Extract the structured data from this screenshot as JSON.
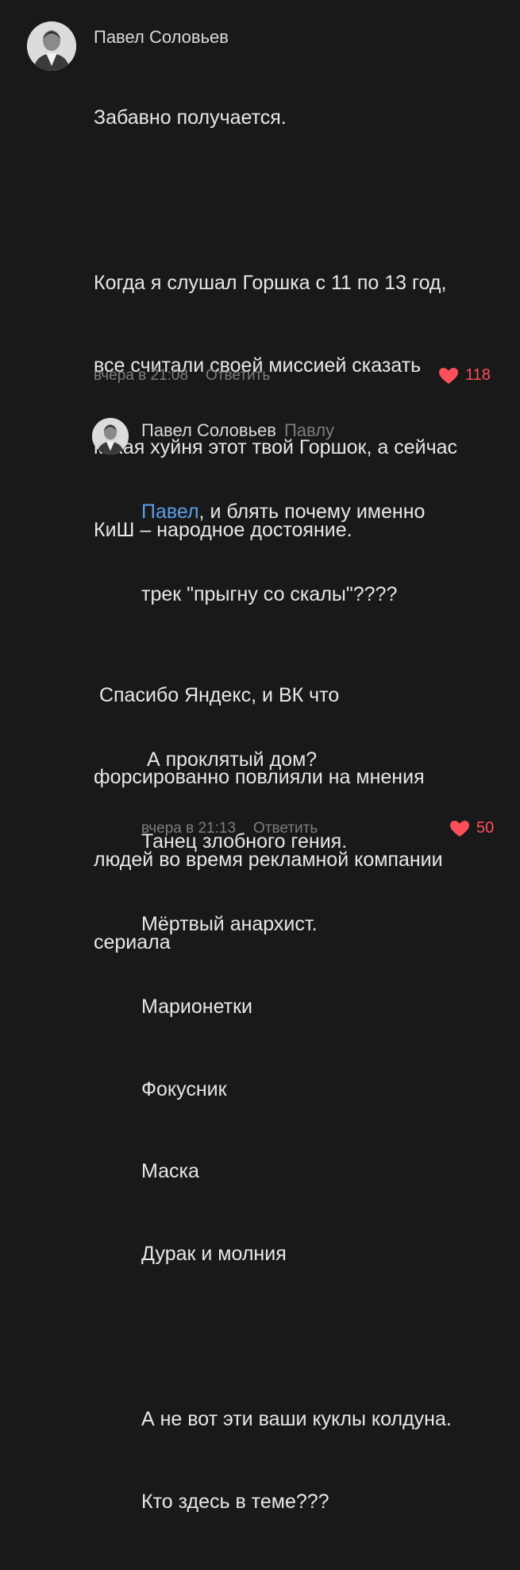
{
  "comments": [
    {
      "author": "Павел Соловьев",
      "reply_to": "",
      "lines": [
        "Забавно получается.",
        "",
        "Когда я слушал Горшка с 11 по 13 год,",
        "все считали своей миссией сказать",
        "какая хуйня этот твой Горшок, а сейчас",
        "КиШ – народное достояние.",
        "",
        " Спасибо Яндекс, и ВК что",
        "форсированно повлияли на мнения",
        "людей во время рекламной компании",
        "сериала"
      ],
      "timestamp": "вчера в 21:08",
      "reply_label": "Ответить",
      "likes": "118",
      "avatar_icon": "user-avatar-icon"
    },
    {
      "author": "Павел Соловьев",
      "reply_to": "Павлу",
      "mention": "Павел",
      "first_line_rest": ", и блять почему именно",
      "lines": [
        "трек \"прыгну со скалы\"????",
        "",
        " А проклятый дом?",
        "Танец злобного гения.",
        "Мёртвый анархист.",
        "Марионетки",
        "Фокусник",
        "Маска",
        "Дурак и молния",
        "",
        "А не вот эти ваши куклы колдуна.",
        "Кто здесь в теме???"
      ],
      "timestamp": "вчера в 21:13",
      "reply_label": "Ответить",
      "likes": "50",
      "avatar_icon": "user-avatar-icon"
    }
  ],
  "colors": {
    "background": "#19191a",
    "text": "#e6e7e9",
    "meta": "#7b7d80",
    "mention": "#5c9ce6",
    "like": "#ff4f5a"
  }
}
